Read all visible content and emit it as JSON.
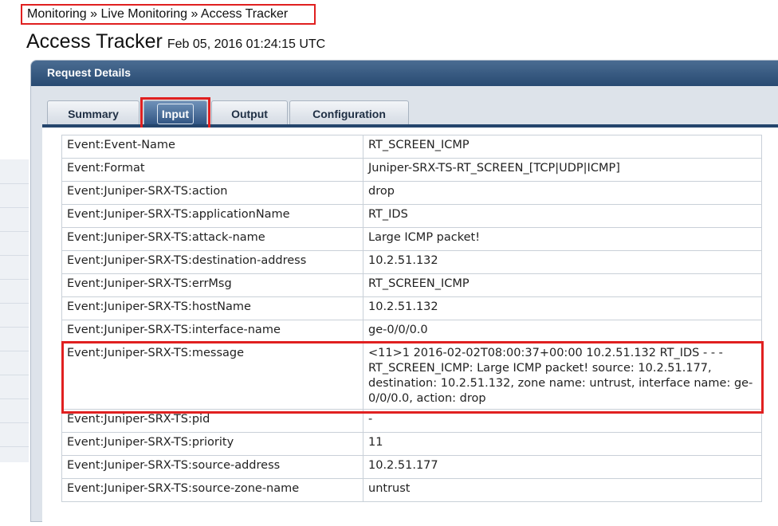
{
  "breadcrumb": "Monitoring » Live Monitoring » Access Tracker",
  "title": "Access Tracker",
  "timestamp": "Feb 05, 2016 01:24:15 UTC",
  "panel": {
    "header": "Request Details"
  },
  "tabs": [
    {
      "label": "Summary"
    },
    {
      "label": "Input"
    },
    {
      "label": "Output"
    },
    {
      "label": "Configuration"
    }
  ],
  "active_tab": "Input",
  "rows": [
    {
      "name": "Event:Event-Name",
      "value": "RT_SCREEN_ICMP"
    },
    {
      "name": "Event:Format",
      "value": "Juniper-SRX-TS-RT_SCREEN_[TCP|UDP|ICMP]"
    },
    {
      "name": "Event:Juniper-SRX-TS:action",
      "value": "drop"
    },
    {
      "name": "Event:Juniper-SRX-TS:applicationName",
      "value": "RT_IDS"
    },
    {
      "name": "Event:Juniper-SRX-TS:attack-name",
      "value": "Large ICMP packet!"
    },
    {
      "name": "Event:Juniper-SRX-TS:destination-address",
      "value": "10.2.51.132"
    },
    {
      "name": "Event:Juniper-SRX-TS:errMsg",
      "value": "RT_SCREEN_ICMP"
    },
    {
      "name": "Event:Juniper-SRX-TS:hostName",
      "value": "10.2.51.132"
    },
    {
      "name": "Event:Juniper-SRX-TS:interface-name",
      "value": "ge-0/0/0.0"
    },
    {
      "name": "Event:Juniper-SRX-TS:message",
      "value": "<11>1 2016-02-02T08:00:37+00:00 10.2.51.132 RT_IDS - - - RT_SCREEN_ICMP: Large ICMP packet! source: 10.2.51.177, destination: 10.2.51.132, zone name: untrust, interface name: ge-0/0/0.0, action: drop"
    },
    {
      "name": "Event:Juniper-SRX-TS:pid",
      "value": "-"
    },
    {
      "name": "Event:Juniper-SRX-TS:priority",
      "value": "11"
    },
    {
      "name": "Event:Juniper-SRX-TS:source-address",
      "value": "10.2.51.177"
    },
    {
      "name": "Event:Juniper-SRX-TS:source-zone-name",
      "value": "untrust"
    }
  ]
}
